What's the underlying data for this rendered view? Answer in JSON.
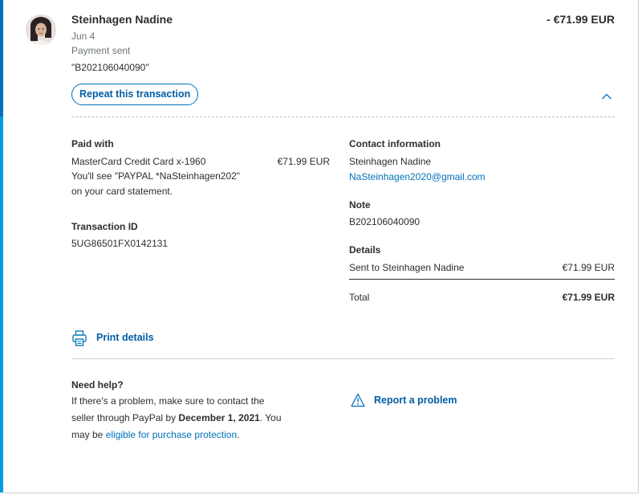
{
  "transaction": {
    "name": "Steinhagen Nadine",
    "amount": "- €71.99 EUR",
    "date": "Jun 4",
    "status": "Payment sent",
    "reference": "\"B202106040090\"",
    "repeat_label": "Repeat this transaction"
  },
  "paid_with": {
    "heading": "Paid with",
    "method": "MasterCard Credit Card x-1960",
    "amount": "€71.99 EUR",
    "statement_line1": "You'll see \"PAYPAL *NaSteinhagen202\"",
    "statement_line2": "on your card statement."
  },
  "transaction_id": {
    "heading": "Transaction ID",
    "value": "5UG86501FX0142131"
  },
  "contact": {
    "heading": "Contact information",
    "name": "Steinhagen Nadine",
    "email": "NaSteinhagen2020@gmail.com"
  },
  "note": {
    "heading": "Note",
    "value": "B202106040090"
  },
  "details": {
    "heading": "Details",
    "sent_label": "Sent to Steinhagen Nadine",
    "sent_amount": "€71.99 EUR",
    "total_label": "Total",
    "total_amount": "€71.99 EUR"
  },
  "print": {
    "label": "Print details",
    "icon": "printer-icon"
  },
  "help": {
    "heading": "Need help?",
    "line1": "If there's a problem, make sure to contact the",
    "line2_prefix": "seller through PayPal by ",
    "line2_date": "December 1, 2021",
    "line2_suffix": ". You",
    "line3_prefix": "may be ",
    "line3_link": "eligible for purchase protection",
    "line3_suffix": "."
  },
  "report": {
    "label": "Report a problem",
    "icon": "warning-icon"
  },
  "colors": {
    "accent": "#0070ba",
    "accent_light": "#009cde",
    "text": "#2c2e2f",
    "muted": "#6c7378"
  }
}
